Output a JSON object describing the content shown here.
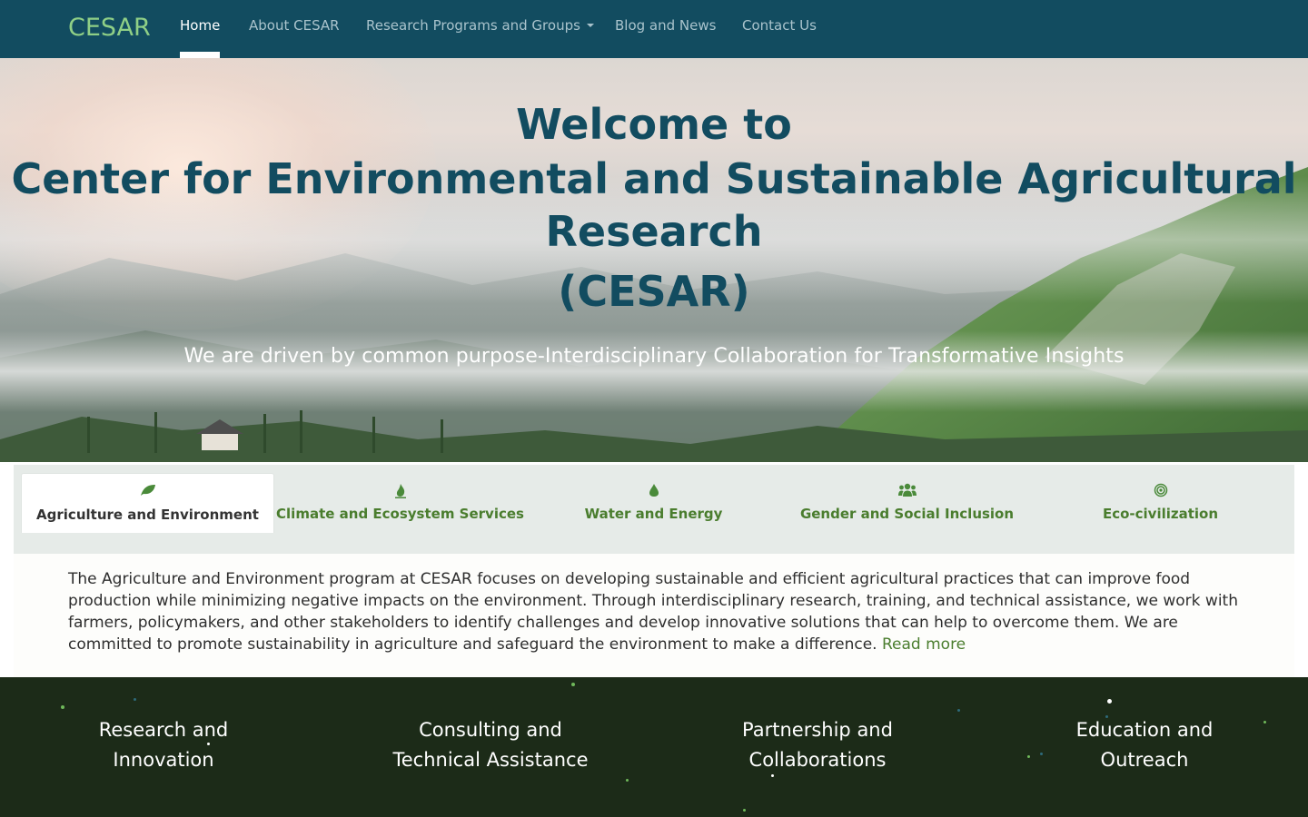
{
  "nav": {
    "brand": "CESAR",
    "items": [
      {
        "label": "Home",
        "active": true
      },
      {
        "label": "About CESAR"
      },
      {
        "label": "Research Programs and Groups",
        "dropdown": true
      },
      {
        "label": "Blog and News"
      },
      {
        "label": "Contact Us"
      }
    ]
  },
  "hero": {
    "title_line1": "Welcome to",
    "title_line2": "Center for Environmental and Sustainable Agricultural",
    "title_line3": "Research",
    "title_line4": "(CESAR)",
    "subtitle": "We are driven by common purpose-Interdisciplinary Collaboration for Transformative Insights"
  },
  "tabs": [
    {
      "label": "Agriculture and Environment",
      "icon": "leaf-icon",
      "active": true
    },
    {
      "label": "Climate and Ecosystem Services",
      "icon": "fire-icon"
    },
    {
      "label": "Water and Energy",
      "icon": "water-drop-icon"
    },
    {
      "label": "Gender and Social Inclusion",
      "icon": "users-icon"
    },
    {
      "label": "Eco-civilization",
      "icon": "bullseye-icon"
    }
  ],
  "content": {
    "text": "The Agriculture and Environment program at CESAR focuses on developing sustainable and efficient agricultural practices that can improve food production while minimizing negative impacts on the environment. Through interdisciplinary research, training, and technical assistance, we work with farmers, policymakers, and other stakeholders to identify challenges and develop innovative solutions that can help to overcome them. We are committed to promote sustainability in agriculture and safeguard the environment to make a difference.",
    "read_more": "Read more"
  },
  "services": [
    {
      "line1": "Research and",
      "line2": "Innovation"
    },
    {
      "line1": "Consulting and",
      "line2": "Technical Assistance"
    },
    {
      "line1": "Partnership and",
      "line2": "Collaborations"
    },
    {
      "line1": "Education and",
      "line2": "Outreach"
    }
  ],
  "colors": {
    "navbar": "#124c60",
    "brand": "#8fcf86",
    "hero_title": "#124c60",
    "tab_accent": "#4a7d2e",
    "services_bg": "#1c2b18"
  }
}
